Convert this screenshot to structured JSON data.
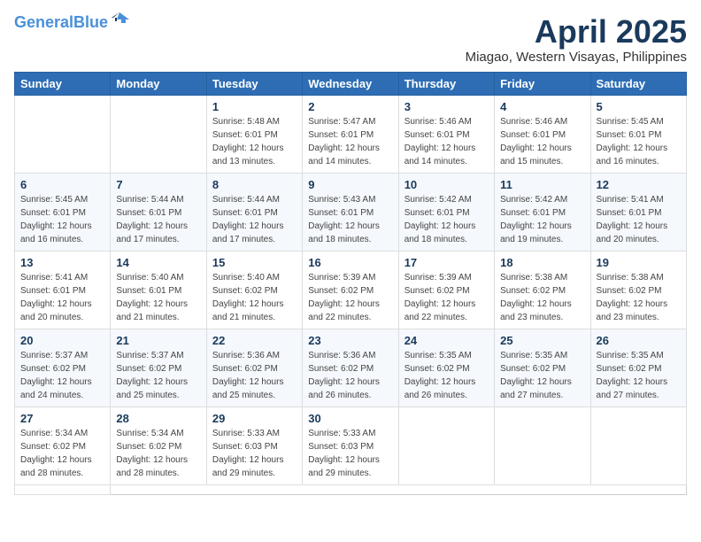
{
  "logo": {
    "line1": "General",
    "line2": "Blue"
  },
  "header": {
    "month": "April 2025",
    "location": "Miagao, Western Visayas, Philippines"
  },
  "weekdays": [
    "Sunday",
    "Monday",
    "Tuesday",
    "Wednesday",
    "Thursday",
    "Friday",
    "Saturday"
  ],
  "days": [
    {
      "date": null
    },
    {
      "date": null
    },
    {
      "date": "1",
      "sunrise": "Sunrise: 5:48 AM",
      "sunset": "Sunset: 6:01 PM",
      "daylight": "Daylight: 12 hours and 13 minutes."
    },
    {
      "date": "2",
      "sunrise": "Sunrise: 5:47 AM",
      "sunset": "Sunset: 6:01 PM",
      "daylight": "Daylight: 12 hours and 14 minutes."
    },
    {
      "date": "3",
      "sunrise": "Sunrise: 5:46 AM",
      "sunset": "Sunset: 6:01 PM",
      "daylight": "Daylight: 12 hours and 14 minutes."
    },
    {
      "date": "4",
      "sunrise": "Sunrise: 5:46 AM",
      "sunset": "Sunset: 6:01 PM",
      "daylight": "Daylight: 12 hours and 15 minutes."
    },
    {
      "date": "5",
      "sunrise": "Sunrise: 5:45 AM",
      "sunset": "Sunset: 6:01 PM",
      "daylight": "Daylight: 12 hours and 16 minutes."
    },
    {
      "date": "6",
      "sunrise": "Sunrise: 5:45 AM",
      "sunset": "Sunset: 6:01 PM",
      "daylight": "Daylight: 12 hours and 16 minutes."
    },
    {
      "date": "7",
      "sunrise": "Sunrise: 5:44 AM",
      "sunset": "Sunset: 6:01 PM",
      "daylight": "Daylight: 12 hours and 17 minutes."
    },
    {
      "date": "8",
      "sunrise": "Sunrise: 5:44 AM",
      "sunset": "Sunset: 6:01 PM",
      "daylight": "Daylight: 12 hours and 17 minutes."
    },
    {
      "date": "9",
      "sunrise": "Sunrise: 5:43 AM",
      "sunset": "Sunset: 6:01 PM",
      "daylight": "Daylight: 12 hours and 18 minutes."
    },
    {
      "date": "10",
      "sunrise": "Sunrise: 5:42 AM",
      "sunset": "Sunset: 6:01 PM",
      "daylight": "Daylight: 12 hours and 18 minutes."
    },
    {
      "date": "11",
      "sunrise": "Sunrise: 5:42 AM",
      "sunset": "Sunset: 6:01 PM",
      "daylight": "Daylight: 12 hours and 19 minutes."
    },
    {
      "date": "12",
      "sunrise": "Sunrise: 5:41 AM",
      "sunset": "Sunset: 6:01 PM",
      "daylight": "Daylight: 12 hours and 20 minutes."
    },
    {
      "date": "13",
      "sunrise": "Sunrise: 5:41 AM",
      "sunset": "Sunset: 6:01 PM",
      "daylight": "Daylight: 12 hours and 20 minutes."
    },
    {
      "date": "14",
      "sunrise": "Sunrise: 5:40 AM",
      "sunset": "Sunset: 6:01 PM",
      "daylight": "Daylight: 12 hours and 21 minutes."
    },
    {
      "date": "15",
      "sunrise": "Sunrise: 5:40 AM",
      "sunset": "Sunset: 6:02 PM",
      "daylight": "Daylight: 12 hours and 21 minutes."
    },
    {
      "date": "16",
      "sunrise": "Sunrise: 5:39 AM",
      "sunset": "Sunset: 6:02 PM",
      "daylight": "Daylight: 12 hours and 22 minutes."
    },
    {
      "date": "17",
      "sunrise": "Sunrise: 5:39 AM",
      "sunset": "Sunset: 6:02 PM",
      "daylight": "Daylight: 12 hours and 22 minutes."
    },
    {
      "date": "18",
      "sunrise": "Sunrise: 5:38 AM",
      "sunset": "Sunset: 6:02 PM",
      "daylight": "Daylight: 12 hours and 23 minutes."
    },
    {
      "date": "19",
      "sunrise": "Sunrise: 5:38 AM",
      "sunset": "Sunset: 6:02 PM",
      "daylight": "Daylight: 12 hours and 23 minutes."
    },
    {
      "date": "20",
      "sunrise": "Sunrise: 5:37 AM",
      "sunset": "Sunset: 6:02 PM",
      "daylight": "Daylight: 12 hours and 24 minutes."
    },
    {
      "date": "21",
      "sunrise": "Sunrise: 5:37 AM",
      "sunset": "Sunset: 6:02 PM",
      "daylight": "Daylight: 12 hours and 25 minutes."
    },
    {
      "date": "22",
      "sunrise": "Sunrise: 5:36 AM",
      "sunset": "Sunset: 6:02 PM",
      "daylight": "Daylight: 12 hours and 25 minutes."
    },
    {
      "date": "23",
      "sunrise": "Sunrise: 5:36 AM",
      "sunset": "Sunset: 6:02 PM",
      "daylight": "Daylight: 12 hours and 26 minutes."
    },
    {
      "date": "24",
      "sunrise": "Sunrise: 5:35 AM",
      "sunset": "Sunset: 6:02 PM",
      "daylight": "Daylight: 12 hours and 26 minutes."
    },
    {
      "date": "25",
      "sunrise": "Sunrise: 5:35 AM",
      "sunset": "Sunset: 6:02 PM",
      "daylight": "Daylight: 12 hours and 27 minutes."
    },
    {
      "date": "26",
      "sunrise": "Sunrise: 5:35 AM",
      "sunset": "Sunset: 6:02 PM",
      "daylight": "Daylight: 12 hours and 27 minutes."
    },
    {
      "date": "27",
      "sunrise": "Sunrise: 5:34 AM",
      "sunset": "Sunset: 6:02 PM",
      "daylight": "Daylight: 12 hours and 28 minutes."
    },
    {
      "date": "28",
      "sunrise": "Sunrise: 5:34 AM",
      "sunset": "Sunset: 6:02 PM",
      "daylight": "Daylight: 12 hours and 28 minutes."
    },
    {
      "date": "29",
      "sunrise": "Sunrise: 5:33 AM",
      "sunset": "Sunset: 6:03 PM",
      "daylight": "Daylight: 12 hours and 29 minutes."
    },
    {
      "date": "30",
      "sunrise": "Sunrise: 5:33 AM",
      "sunset": "Sunset: 6:03 PM",
      "daylight": "Daylight: 12 hours and 29 minutes."
    },
    {
      "date": null
    },
    {
      "date": null
    },
    {
      "date": null
    },
    {
      "date": null
    }
  ]
}
